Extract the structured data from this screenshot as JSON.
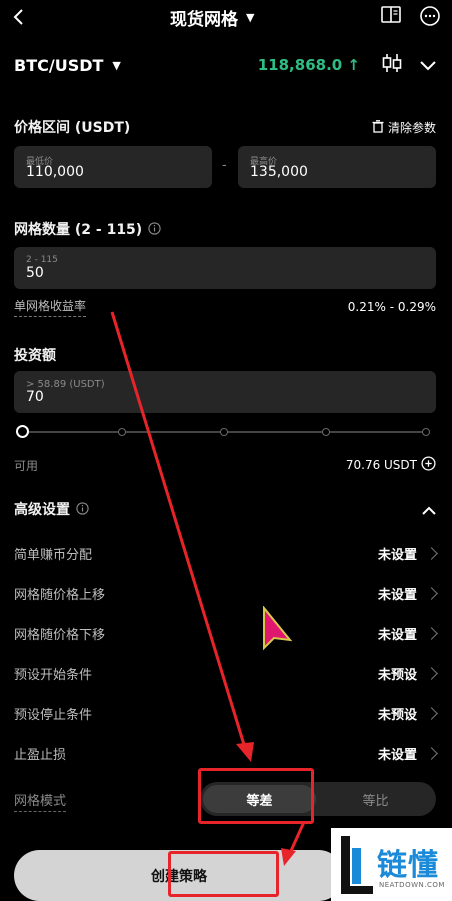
{
  "header": {
    "title": "现货网格"
  },
  "pair": {
    "symbol": "BTC/USDT",
    "price": "118,868.0 ↑"
  },
  "price_range": {
    "label": "价格区间 (USDT)",
    "clear_label": "清除参数",
    "min": {
      "placeholder": "最低价",
      "value": "110,000"
    },
    "max": {
      "placeholder": "最高价",
      "value": "135,000"
    },
    "dash": "-"
  },
  "grid_count": {
    "label": "网格数量 (2 - 115)",
    "placeholder": "2 - 115",
    "value": "50",
    "profit_label": "单网格收益率",
    "profit_value": "0.21% - 0.29%"
  },
  "investment": {
    "label": "投资额",
    "placeholder": "> 58.89 (USDT)",
    "value": "70",
    "slider_fraction": 0,
    "available_label": "可用",
    "available_value": "70.76 USDT"
  },
  "advanced": {
    "label": "高级设置",
    "items": [
      {
        "name": "简单赚币分配",
        "status": "未设置"
      },
      {
        "name": "网格随价格上移",
        "status": "未设置"
      },
      {
        "name": "网格随价格下移",
        "status": "未设置"
      },
      {
        "name": "预设开始条件",
        "status": "未预设"
      },
      {
        "name": "预设停止条件",
        "status": "未预设"
      },
      {
        "name": "止盈止损",
        "status": "未设置"
      }
    ],
    "mode_label": "网格模式",
    "mode_options": [
      "等差",
      "等比"
    ]
  },
  "create_button": "创建策略",
  "watermark": {
    "cn": "链懂",
    "en": "NEATDOWN.COM"
  },
  "colors": {
    "price_green": "#2ebd85",
    "annotation_red": "#e8242b",
    "accent_pink": "#e0176f"
  }
}
